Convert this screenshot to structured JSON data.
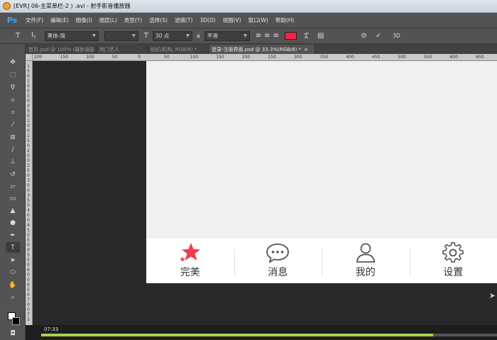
{
  "window": {
    "title": "[EVR] 06-主菜单栏-2 ) .avi - 射手影音播放器"
  },
  "menu": [
    "文件(F)",
    "编辑(E)",
    "图像(I)",
    "图层(L)",
    "类型(Y)",
    "选择(S)",
    "滤镜(T)",
    "3D(D)",
    "视图(V)",
    "窗口(W)",
    "帮助(H)"
  ],
  "options": {
    "font_family": "黑体-简",
    "font_style": "-",
    "font_size": "30 点",
    "antialias_prefix": "a",
    "antialias": "平滑",
    "text_color": "#ff1f44",
    "three_d": "3D"
  },
  "doc_tabs": [
    "首页.psd @ 100% (最新通告",
    "热门艺人",
    "经纪/机构, RGB/8) *",
    "登录-注册界面.psd @ 33.3%(RGB/8) *"
  ],
  "ruler_h": [
    "200",
    "150",
    "100",
    "50",
    "0",
    "50",
    "100",
    "150",
    "200",
    "250",
    "300",
    "350",
    "400",
    "450",
    "500",
    "550",
    "600",
    "650"
  ],
  "ruler_v": [
    "1",
    "5",
    "0",
    "1",
    "0",
    "0",
    "5",
    "0",
    "0",
    "5",
    "0",
    "1",
    "0",
    "0",
    "1",
    "5",
    "0",
    "2",
    "0",
    "0",
    "2",
    "5",
    "0",
    "3",
    "0",
    "0",
    "3",
    "5",
    "0",
    "4",
    "0",
    "0",
    "4",
    "5",
    "0",
    "5",
    "0",
    "0",
    "5",
    "5",
    "0",
    "6",
    "0",
    "0",
    "6",
    "5",
    "0",
    "7",
    "0",
    "0",
    "7",
    "5"
  ],
  "tab_nav": [
    {
      "label": "完美",
      "icon": "star-icon",
      "color": "#ef3b4d"
    },
    {
      "label": "消息",
      "icon": "chat-bubble-icon",
      "color": "#555555"
    },
    {
      "label": "我的",
      "icon": "user-icon",
      "color": "#555555"
    },
    {
      "label": "设置",
      "icon": "gear-icon",
      "color": "#555555"
    }
  ],
  "player": {
    "time": "07:33",
    "progress": 0.86
  }
}
